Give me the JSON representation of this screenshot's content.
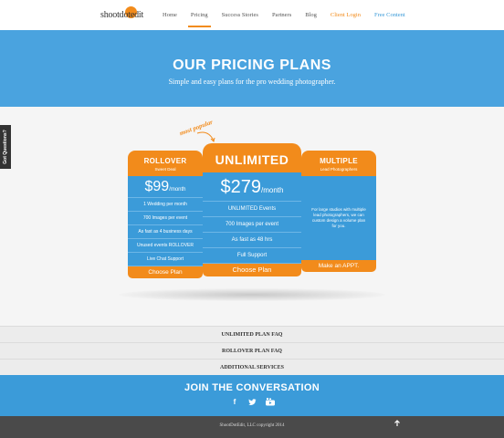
{
  "nav": {
    "logo_text": "shootdotedit",
    "links": [
      "Home",
      "Pricing",
      "Success Stories",
      "Partners",
      "Blog",
      "Client Login",
      "Free Content"
    ]
  },
  "hero": {
    "title": "OUR PRICING PLANS",
    "subtitle": "Simple and easy plans for the pro wedding photographer."
  },
  "side_tab": "Got Questions?",
  "most_popular": "most popular",
  "plans": {
    "rollover": {
      "name": "ROLLOVER",
      "tag": "Sweet Deal",
      "price": "$99",
      "per": "/month",
      "features": [
        "1 Wedding per month",
        "700 Images per event",
        "As fast as 4 business days",
        "Unused events ROLLOVER",
        "Live Chat Support"
      ],
      "cta": "Choose Plan"
    },
    "unlimited": {
      "name": "UNLIMITED",
      "price": "$279",
      "per": "/month",
      "features": [
        "UNLIMITED Events",
        "700 Images per event",
        "As fast as 48 hrs",
        "Full Support"
      ],
      "cta": "Choose Plan"
    },
    "multiple": {
      "name": "MULTIPLE",
      "tag": "Lead Photographers",
      "description": "For large studios with multiple lead photographers, we can custom design a volume plan for you.",
      "cta": "Make an APPT."
    }
  },
  "faq": [
    "UNLIMITED PLAN FAQ",
    "ROLLOVER PLAN FAQ",
    "ADDITIONAL SERVICES"
  ],
  "join": {
    "title": "JOIN THE CONVERSATION",
    "icons": [
      "facebook-icon",
      "twitter-icon",
      "youtube-icon"
    ]
  },
  "footer": {
    "copyright": "ShootDotEdit, LLC copyright 2014",
    "to_top_icon": "arrow-up-icon"
  },
  "colors": {
    "accent_orange": "#f28b1b",
    "brand_blue": "#3b9bd9",
    "hero_blue": "#4aa3df",
    "footer_dark": "#4a4a4a"
  }
}
